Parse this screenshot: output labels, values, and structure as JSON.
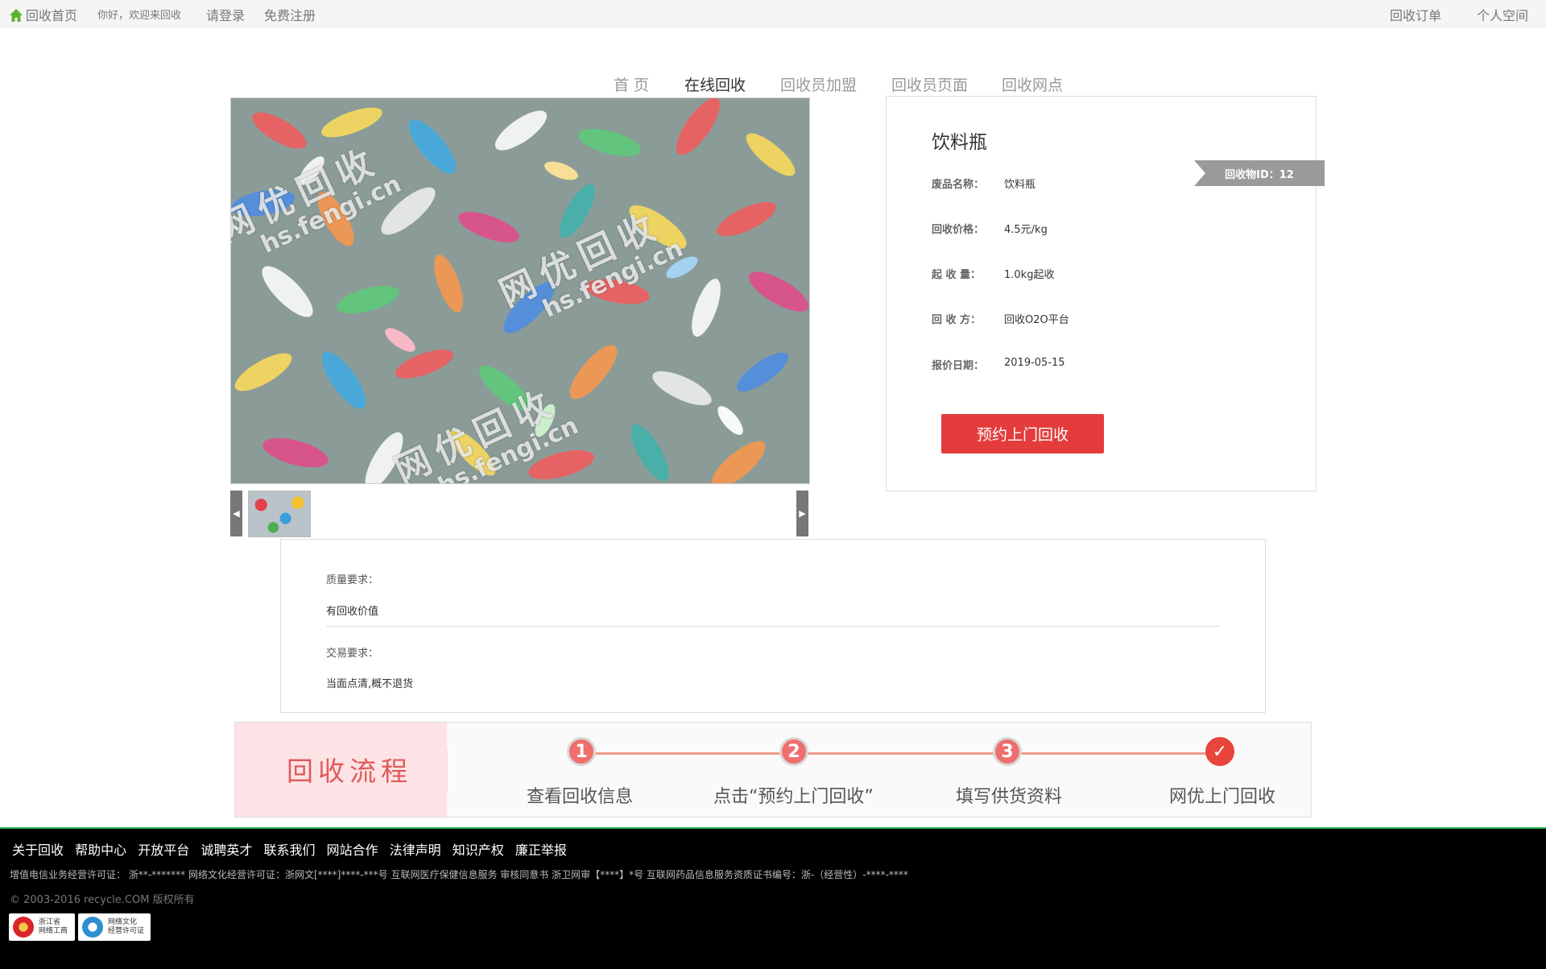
{
  "topbar": {
    "home_label": "回收首页",
    "welcome": "你好，欢迎来回收",
    "login": "请登录",
    "register": "免费注册",
    "orders": "回收订单",
    "personal": "个人空间"
  },
  "nav": {
    "items": [
      "首 页",
      "在线回收",
      "回收员加盟",
      "回收员页面",
      "回收网点"
    ],
    "active_index": 1
  },
  "image": {
    "watermark_cn": "网优回收",
    "watermark_en": "hs.fengi.cn"
  },
  "product": {
    "title": "饮料瓶",
    "id_tag": "回收物ID：12",
    "fields": [
      {
        "label": "废品名称：",
        "value": "饮料瓶"
      },
      {
        "label": "回收价格：",
        "value": "4.5元/kg"
      },
      {
        "label": "起 收 量：",
        "value": "1.0kg起收"
      },
      {
        "label": "回 收 方：",
        "value": "回收O2O平台"
      },
      {
        "label": "报价日期：",
        "value": "2019-05-15"
      }
    ],
    "book_button": "预约上门回收"
  },
  "requirements": {
    "quality_label": "质量要求：",
    "quality_value": "有回收价值",
    "trade_label": "交易要求：",
    "trade_value": "当面点清,概不退货"
  },
  "process": {
    "title": "回收流程",
    "steps": [
      {
        "num": "1",
        "label": "查看回收信息"
      },
      {
        "num": "2",
        "label": "点击“预约上门回收”"
      },
      {
        "num": "3",
        "label": "填写供货资料"
      },
      {
        "num": "✓",
        "label": "网优上门回收"
      }
    ]
  },
  "footer": {
    "links": [
      "关于回收",
      "帮助中心",
      "开放平台",
      "诚聘英才",
      "联系我们",
      "网站合作",
      "法律声明",
      "知识产权",
      "廉正举报"
    ],
    "license": "增值电信业务经营许可证：  浙**-******* 网络文化经营许可证：浙网文[****]****-***号 互联网医疗保健信息服务 审核同意书 浙卫网审【****】*号 互联网药品信息服务资质证书编号：浙-（经营性）-****-****",
    "copyright": "© 2003-2016 recycle.COM 版权所有",
    "badge1_line1": "浙江省",
    "badge1_line2": "网络工商",
    "badge2_line1": "网络文化",
    "badge2_line2": "经营许可证"
  },
  "colors": {
    "accent_green": "#5cb531",
    "book_button": "#e43c3c",
    "process_bg": "#fde3e5",
    "process_line": "#f39a8a",
    "footer_bg": "#000000"
  }
}
